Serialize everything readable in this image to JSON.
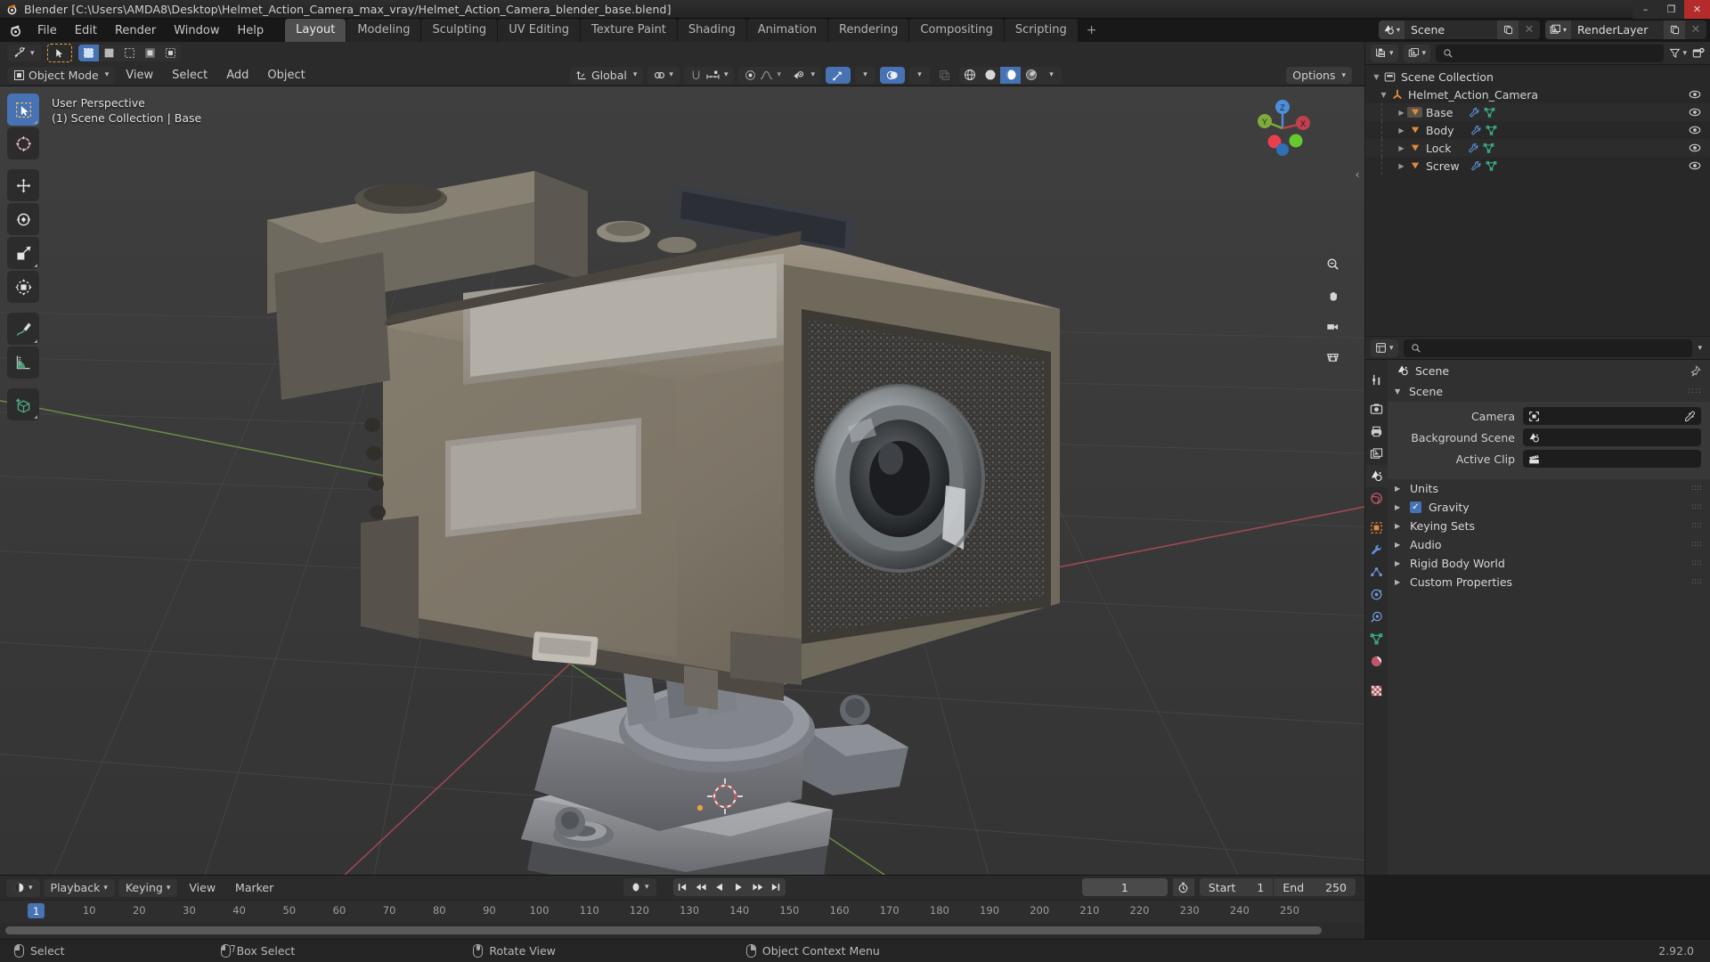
{
  "window": {
    "title": "Blender [C:\\Users\\AMDA8\\Desktop\\Helmet_Action_Camera_max_vray/Helmet_Action_Camera_blender_base.blend]",
    "minimize": "–",
    "maximize": "❐",
    "close": "✕"
  },
  "topbar": {
    "menus": [
      "File",
      "Edit",
      "Render",
      "Window",
      "Help"
    ],
    "workspaces": [
      "Layout",
      "Modeling",
      "Sculpting",
      "UV Editing",
      "Texture Paint",
      "Shading",
      "Animation",
      "Rendering",
      "Compositing",
      "Scripting"
    ],
    "active_workspace": "Layout",
    "add_workspace": "+",
    "scene_name": "Scene",
    "viewlayer_name": "RenderLayer"
  },
  "viewport": {
    "mode": "Object Mode",
    "menus": [
      "View",
      "Select",
      "Add",
      "Object"
    ],
    "transform_orientation": "Global",
    "options_label": "Options",
    "overlay_line1": "User Perspective",
    "overlay_line2": "(1) Scene Collection | Base",
    "gizmo_axes": [
      "X",
      "Y",
      "Z"
    ],
    "collapse_arrow": "‹"
  },
  "timeline": {
    "playback": "Playback",
    "keying": "Keying",
    "view": "View",
    "marker": "Marker",
    "current_frame": "1",
    "start_label": "Start",
    "start_value": "1",
    "end_label": "End",
    "end_value": "250",
    "ticks": [
      "1",
      "10",
      "20",
      "30",
      "40",
      "50",
      "60",
      "70",
      "80",
      "90",
      "100",
      "110",
      "120",
      "130",
      "140",
      "150",
      "160",
      "170",
      "180",
      "190",
      "200",
      "210",
      "220",
      "230",
      "240",
      "250"
    ],
    "playhead_frame": "1"
  },
  "outliner": {
    "root": "Scene Collection",
    "collection": "Helmet_Action_Camera",
    "objects": [
      {
        "name": "Base",
        "active": true
      },
      {
        "name": "Body",
        "active": false
      },
      {
        "name": "Lock",
        "active": false
      },
      {
        "name": "Screw",
        "active": false
      }
    ],
    "search_placeholder": ""
  },
  "properties": {
    "breadcrumb": "Scene",
    "search_placeholder": "",
    "panel_scene": "Scene",
    "fields": [
      {
        "label": "Camera",
        "value": "",
        "icon": "camera-data-icon"
      },
      {
        "label": "Background Scene",
        "value": "",
        "icon": "scene-icon"
      },
      {
        "label": "Active Clip",
        "value": "",
        "icon": "clip-icon"
      }
    ],
    "sections": [
      {
        "label": "Units",
        "checkbox": false
      },
      {
        "label": "Gravity",
        "checkbox": true
      },
      {
        "label": "Keying Sets",
        "checkbox": false
      },
      {
        "label": "Audio",
        "checkbox": false
      },
      {
        "label": "Rigid Body World",
        "checkbox": false
      },
      {
        "label": "Custom Properties",
        "checkbox": false
      }
    ]
  },
  "statusbar": {
    "items": [
      "Select",
      "Box Select",
      "Rotate View",
      "Object Context Menu"
    ],
    "version": "2.92.0"
  },
  "colors": {
    "accent_blue": "#4772b3",
    "axis_x": "#cc4455",
    "axis_y": "#8ec641",
    "axis_z": "#3b83ce",
    "orange": "#e08a3c",
    "bg_dark": "#1d1d1d",
    "viewport_bg": "#3a3a3a"
  }
}
